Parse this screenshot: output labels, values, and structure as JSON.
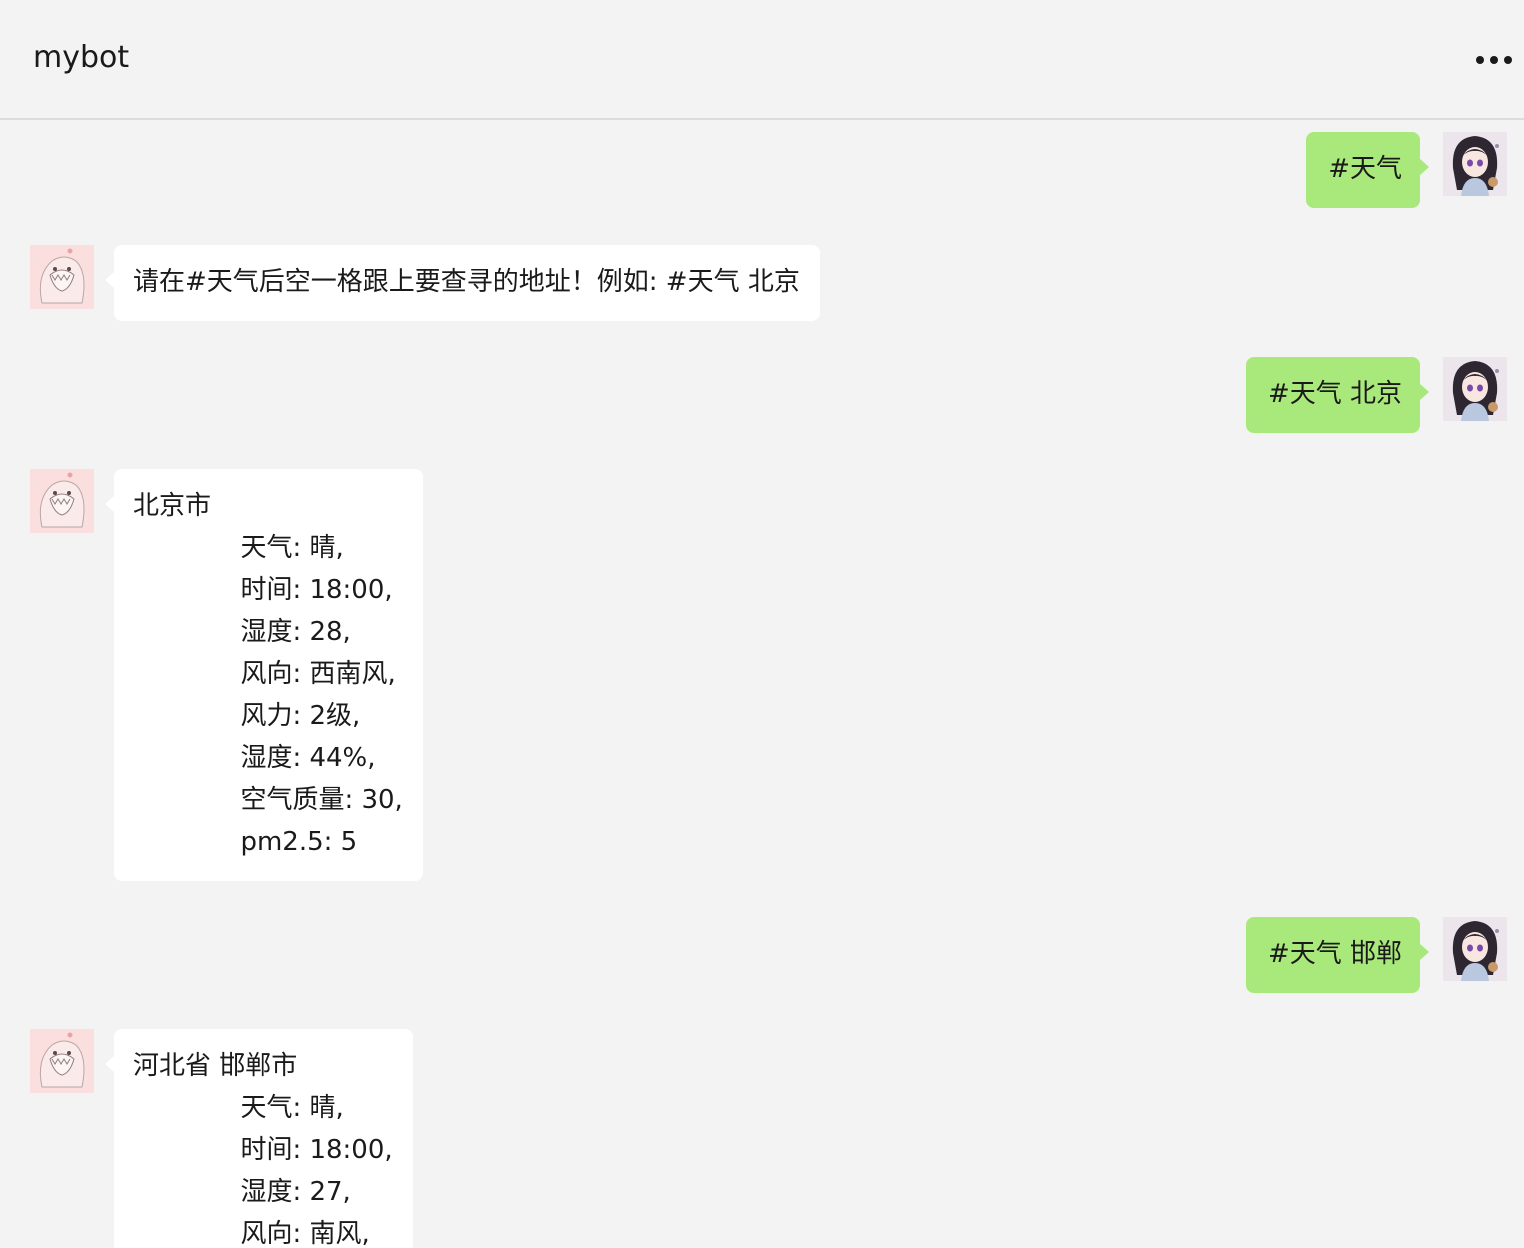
{
  "header": {
    "title": "mybot",
    "more_icon": "more-horizontal-icon"
  },
  "avatars": {
    "user": "anime-girl-avatar",
    "bot": "pink-creature-avatar"
  },
  "colors": {
    "background": "#f3f3f3",
    "outgoing_bubble": "#a9e87a",
    "incoming_bubble": "#ffffff"
  },
  "messages": [
    {
      "sender": "user",
      "text": "#天气"
    },
    {
      "sender": "bot",
      "text": "请在#天气后空一格跟上要查寻的地址！例如: #天气 北京"
    },
    {
      "sender": "user",
      "text": "#天气 北京"
    },
    {
      "sender": "bot",
      "text": "北京市\n             天气: 晴,\n             时间: 18:00,\n             湿度: 28,\n             风向: 西南风,\n             风力: 2级,\n             湿度: 44%,\n             空气质量: 30,\n             pm2.5: 5"
    },
    {
      "sender": "user",
      "text": "#天气 邯郸"
    },
    {
      "sender": "bot",
      "text": "河北省 邯郸市\n             天气: 晴,\n             时间: 18:00,\n             湿度: 27,\n             风向: 南风,"
    }
  ]
}
